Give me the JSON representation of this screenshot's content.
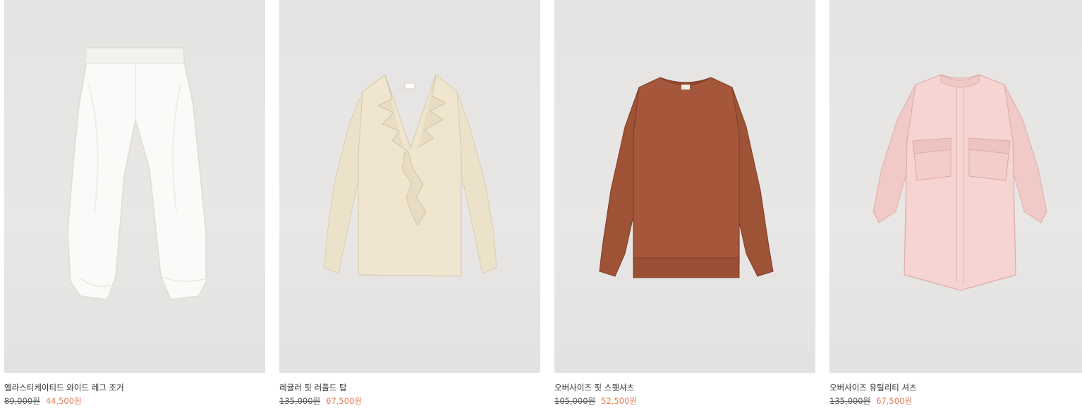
{
  "products": [
    {
      "name": "엘라스티케이티드 와이드 레그 조거",
      "original_price": "89,000원",
      "sale_price": "44,500원",
      "image_icon": "white-pants-image",
      "color": "#f8f7f4"
    },
    {
      "name": "레귤러 핏 러플드 탑",
      "original_price": "135,000원",
      "sale_price": "67,500원",
      "image_icon": "cream-ruffled-blouse-image",
      "color": "#efe4cd"
    },
    {
      "name": "오버사이즈 핏 스웻셔츠",
      "original_price": "105,000원",
      "sale_price": "52,500원",
      "image_icon": "brown-sweatshirt-image",
      "color": "#a6573b"
    },
    {
      "name": "오버사이즈 유틸리티 셔츠",
      "original_price": "135,000원",
      "sale_price": "67,500원",
      "image_icon": "pink-utility-shirt-image",
      "color": "#f4d2cf"
    }
  ],
  "theme": {
    "sale_color": "#e27b54",
    "image_background": "#e7e5e3"
  }
}
